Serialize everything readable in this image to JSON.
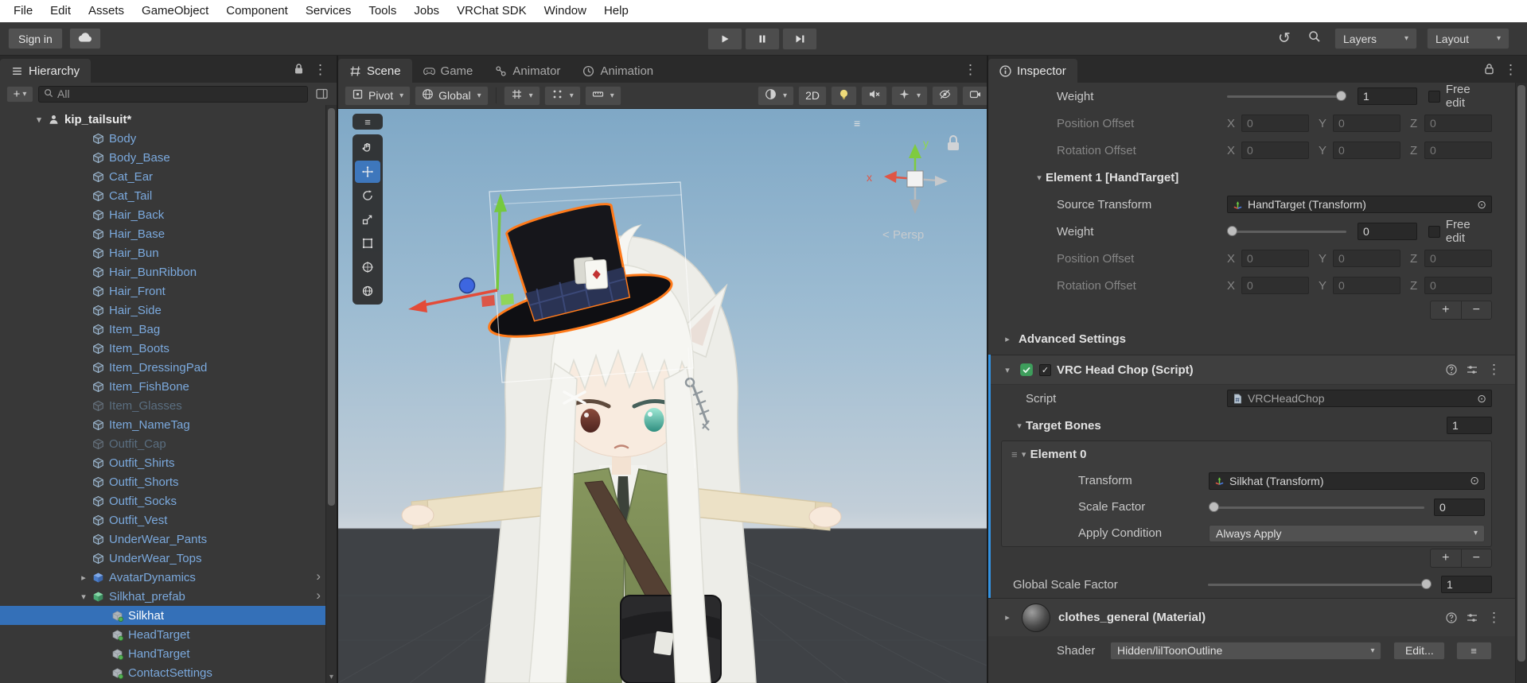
{
  "icons": {
    "caret": "▾",
    "collapse": "▾",
    "expand": "▸",
    "chevron": "›",
    "kebab": "⋮",
    "menu_handle": "≡",
    "picker": "⊙",
    "history": "↺",
    "plus": "+",
    "minus": "−",
    "check": "✓",
    "persp_toggle": "<"
  },
  "menu": {
    "items": [
      "File",
      "Edit",
      "Assets",
      "GameObject",
      "Component",
      "Services",
      "Tools",
      "Jobs",
      "VRChat SDK",
      "Window",
      "Help"
    ]
  },
  "toolbar": {
    "sign_in_label": "Sign in",
    "layers_label": "Layers",
    "layout_label": "Layout"
  },
  "hierarchy": {
    "tab": "Hierarchy",
    "search_text": "All",
    "items": [
      {
        "label": "kip_tailsuit*",
        "icon": "avatar-icon",
        "state": "root",
        "indent": 40,
        "expander": "open"
      },
      {
        "label": "Body",
        "icon": "mesh-icon",
        "state": "prefab",
        "indent": 96
      },
      {
        "label": "Body_Base",
        "icon": "mesh-icon",
        "state": "prefab",
        "indent": 96
      },
      {
        "label": "Cat_Ear",
        "icon": "mesh-icon",
        "state": "prefab",
        "indent": 96
      },
      {
        "label": "Cat_Tail",
        "icon": "mesh-icon",
        "state": "prefab",
        "indent": 96
      },
      {
        "label": "Hair_Back",
        "icon": "mesh-icon",
        "state": "prefab",
        "indent": 96
      },
      {
        "label": "Hair_Base",
        "icon": "mesh-icon",
        "state": "prefab",
        "indent": 96
      },
      {
        "label": "Hair_Bun",
        "icon": "mesh-icon",
        "state": "prefab",
        "indent": 96
      },
      {
        "label": "Hair_BunRibbon",
        "icon": "mesh-icon",
        "state": "prefab",
        "indent": 96
      },
      {
        "label": "Hair_Front",
        "icon": "mesh-icon",
        "state": "prefab",
        "indent": 96
      },
      {
        "label": "Hair_Side",
        "icon": "mesh-icon",
        "state": "prefab",
        "indent": 96
      },
      {
        "label": "Item_Bag",
        "icon": "mesh-icon",
        "state": "prefab",
        "indent": 96
      },
      {
        "label": "Item_Boots",
        "icon": "mesh-icon",
        "state": "prefab",
        "indent": 96
      },
      {
        "label": "Item_DressingPad",
        "icon": "mesh-icon",
        "state": "prefab",
        "indent": 96
      },
      {
        "label": "Item_FishBone",
        "icon": "mesh-icon",
        "state": "prefab",
        "indent": 96
      },
      {
        "label": "Item_Glasses",
        "icon": "mesh-icon",
        "state": "disabled",
        "indent": 96
      },
      {
        "label": "Item_NameTag",
        "icon": "mesh-icon",
        "state": "prefab",
        "indent": 96
      },
      {
        "label": "Outfit_Cap",
        "icon": "mesh-icon",
        "state": "disabled",
        "indent": 96
      },
      {
        "label": "Outfit_Shirts",
        "icon": "mesh-icon",
        "state": "prefab",
        "indent": 96
      },
      {
        "label": "Outfit_Shorts",
        "icon": "mesh-icon",
        "state": "prefab",
        "indent": 96
      },
      {
        "label": "Outfit_Socks",
        "icon": "mesh-icon",
        "state": "prefab",
        "indent": 96
      },
      {
        "label": "Outfit_Vest",
        "icon": "mesh-icon",
        "state": "prefab",
        "indent": 96
      },
      {
        "label": "UnderWear_Pants",
        "icon": "mesh-icon",
        "state": "prefab",
        "indent": 96
      },
      {
        "label": "UnderWear_Tops",
        "icon": "mesh-icon",
        "state": "prefab",
        "indent": 96
      },
      {
        "label": "AvatarDynamics",
        "icon": "blue-cube-icon",
        "state": "prefab",
        "indent": 96,
        "expander": "closed",
        "chevron": true
      },
      {
        "label": "Silkhat_prefab",
        "icon": "prefab-icon",
        "state": "prefab",
        "indent": 96,
        "expander": "open",
        "chevron": true
      },
      {
        "label": "Silkhat",
        "icon": "prefab-child-icon",
        "state": "selected",
        "indent": 120
      },
      {
        "label": "HeadTarget",
        "icon": "prefab-child-icon",
        "state": "prefab",
        "indent": 120
      },
      {
        "label": "HandTarget",
        "icon": "prefab-child-icon",
        "state": "prefab",
        "indent": 120
      },
      {
        "label": "ContactSettings",
        "icon": "prefab-child-icon",
        "state": "prefab",
        "indent": 120
      }
    ]
  },
  "scene": {
    "tabs": [
      {
        "label": "Scene"
      },
      {
        "label": "Game"
      },
      {
        "label": "Animator"
      },
      {
        "label": "Animation"
      }
    ],
    "toolbar": {
      "pivot_label": "Pivot",
      "global_label": "Global",
      "two_d_label": "2D"
    },
    "viewport": {
      "persp_label": "Persp",
      "axis_x": "x",
      "axis_y": "y"
    }
  },
  "inspector": {
    "tab": "Inspector",
    "zero": "0",
    "constraint": {
      "weight_label": "Weight",
      "weight_value": "1",
      "free_edit_label": "Free edit",
      "position_offset_label": "Position Offset",
      "rotation_offset_label": "Rotation Offset",
      "axis_x": "X",
      "axis_y": "Y",
      "axis_z": "Z",
      "element1_label": "Element 1 [HandTarget]",
      "source_transform_label": "Source Transform",
      "source_transform_value": "HandTarget (Transform)",
      "element1_weight_value": "0"
    },
    "advanced_settings_label": "Advanced Settings",
    "head_chop": {
      "title": "VRC Head Chop (Script)",
      "script_label": "Script",
      "script_value": "VRCHeadChop",
      "target_bones_label": "Target Bones",
      "target_bones_size": "1",
      "element0_label": "Element 0",
      "transform_label": "Transform",
      "transform_value": "Silkhat (Transform)",
      "scale_factor_label": "Scale Factor",
      "scale_factor_value": "0",
      "apply_condition_label": "Apply Condition",
      "apply_condition_value": "Always Apply",
      "global_scale_label": "Global Scale Factor",
      "global_scale_value": "1"
    },
    "material": {
      "title": "clothes_general (Material)",
      "shader_label": "Shader",
      "shader_value": "Hidden/lilToonOutline",
      "edit_label": "Edit..."
    }
  }
}
